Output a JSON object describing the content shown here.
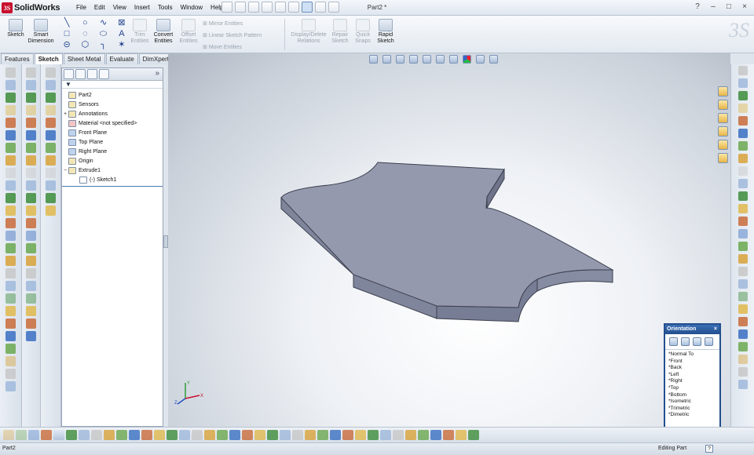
{
  "app": {
    "brand": "SolidWorks",
    "logo_text": "3S",
    "document_title": "Part2 *",
    "window_controls": [
      "?",
      "–",
      "□",
      "×"
    ]
  },
  "menu": [
    "File",
    "Edit",
    "View",
    "Insert",
    "Tools",
    "Window",
    "Help"
  ],
  "command_manager": {
    "sketch": "Sketch",
    "smart_dimension_1": "Smart",
    "smart_dimension_2": "Dimension",
    "trim_entities_1": "Trim",
    "trim_entities_2": "Entities",
    "convert_entities_1": "Convert",
    "convert_entities_2": "Entities",
    "offset_entities_1": "Offset",
    "offset_entities_2": "Entities",
    "mirror_entities": "Mirror Entities",
    "linear_sketch_pattern": "Linear Sketch Pattern",
    "move_entities": "Move Entities",
    "display_delete_relations_1": "Display/Delete",
    "display_delete_relations_2": "Relations",
    "repair_sketch_1": "Repair",
    "repair_sketch_2": "Sketch",
    "quick_snaps_1": "Quick",
    "quick_snaps_2": "Snaps",
    "rapid_sketch_1": "Rapid",
    "rapid_sketch_2": "Sketch"
  },
  "tabs": [
    "Features",
    "Sketch",
    "Sheet Metal",
    "Evaluate",
    "DimXpert"
  ],
  "active_tab": "Sketch",
  "feature_tree": {
    "part": "Part2",
    "items": [
      {
        "label": "Sensors",
        "expander": ""
      },
      {
        "label": "Annotations",
        "expander": "+"
      },
      {
        "label": "Material <not specified>",
        "expander": ""
      },
      {
        "label": "Front Plane",
        "expander": ""
      },
      {
        "label": "Top Plane",
        "expander": ""
      },
      {
        "label": "Right Plane",
        "expander": ""
      },
      {
        "label": "Origin",
        "expander": ""
      },
      {
        "label": "Extrude1",
        "expander": "−"
      },
      {
        "label": "(-) Sketch1",
        "expander": ""
      }
    ]
  },
  "orientation": {
    "title": "Orientation",
    "close": "×",
    "views": [
      "*Normal To",
      "*Front",
      "*Back",
      "*Left",
      "*Right",
      "*Top",
      "*Bottom",
      "*Isometric",
      "*Trimetric",
      "*Dimetric"
    ]
  },
  "triad": {
    "x": "X",
    "y": "Y",
    "z": "Z"
  },
  "status": {
    "left": "Part2",
    "right": "Editing Part",
    "help": "?"
  },
  "colors": {
    "accent": "#234f8e",
    "model_top": "#9499b0",
    "model_side": "#7c8299"
  }
}
